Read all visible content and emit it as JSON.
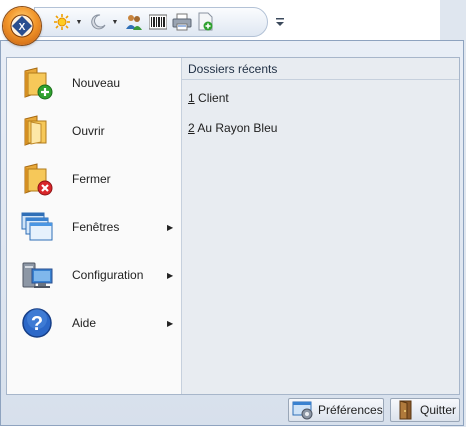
{
  "quick_access": {
    "items": [
      {
        "icon": "sun-icon"
      },
      {
        "icon": "moon-icon"
      },
      {
        "icon": "users-icon"
      },
      {
        "icon": "barcode-icon"
      },
      {
        "icon": "printer-icon"
      },
      {
        "icon": "document-add-icon"
      }
    ]
  },
  "menu": {
    "items": [
      {
        "label": "Nouveau",
        "icon": "folder-new-icon"
      },
      {
        "label": "Ouvrir",
        "icon": "folder-open-icon"
      },
      {
        "label": "Fermer",
        "icon": "folder-close-icon"
      },
      {
        "label": "Fenêtres",
        "icon": "windows-icon",
        "submenu_arrow": "▶"
      },
      {
        "label": "Configuration",
        "icon": "computer-config-icon",
        "submenu_arrow": "▶"
      },
      {
        "label": "Aide",
        "icon": "help-icon",
        "submenu_arrow": "▶"
      }
    ]
  },
  "recent": {
    "title": "Dossiers récents",
    "items": [
      {
        "accel": "1",
        "name": " Client"
      },
      {
        "accel": "2",
        "name": " Au Rayon Bleu"
      }
    ]
  },
  "footer": {
    "preferences_label": "Préférences",
    "quit_label": "Quitter"
  },
  "colors": {
    "app_button": "#f2962a",
    "menu_frame": "#dde5f0",
    "recent_pane": "#e8ecf1",
    "add_badge": "#2fa12f",
    "close_badge": "#d9262a"
  }
}
